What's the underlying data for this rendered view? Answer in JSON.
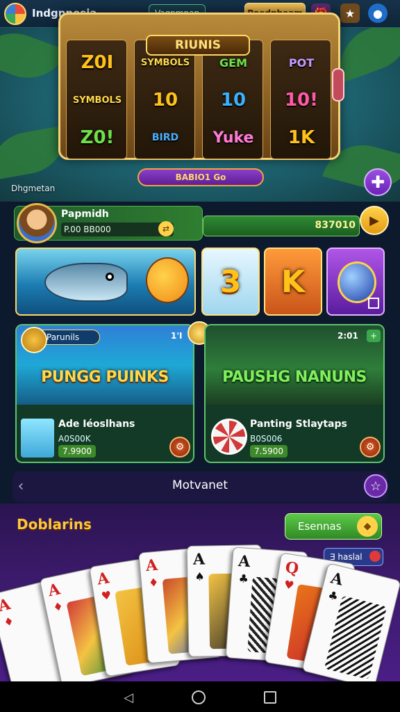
{
  "header": {
    "region": "Indgnnesia",
    "center_chip": "Vagnmpan",
    "top_button": "Poednheam"
  },
  "hero": {
    "slot_title": "RIUNIS",
    "reels": [
      [
        "Z0I",
        "SYMBOLS",
        "Z0!"
      ],
      [
        "SYMBOLS",
        "10",
        "BIRD"
      ],
      [
        "GEM",
        "10",
        "Yuke"
      ],
      [
        "POT",
        "10!",
        "1K"
      ]
    ],
    "slot_label": "BABIO1 Go",
    "caption": "Dhgmetan"
  },
  "profile": {
    "name": "Papmidh",
    "sub": "P.00 BB000",
    "balance": "837010"
  },
  "tiles": [
    {
      "label": "3"
    },
    {
      "label": "K"
    }
  ],
  "features": [
    {
      "chip": "Parunils",
      "time": "1'I",
      "title": "PUNGG PUINKS",
      "name": "Ade Iéoslhans",
      "sub": "A0S00K",
      "price": "7.9900"
    },
    {
      "time": "2:01",
      "title": "PAUSHG NANUNS",
      "name": "Panting Stlaytaps",
      "sub": "B0S006",
      "price": "7.5900"
    }
  ],
  "section_nav": {
    "title": "Motvanet"
  },
  "cards_section": {
    "heading": "Doblarins",
    "button": "Esennas",
    "chip": "∃ haslal"
  },
  "cards": [
    {
      "rank": "A",
      "suit": "♦",
      "color": "#d12020"
    },
    {
      "rank": "A",
      "suit": "♦",
      "color": "#d12020"
    },
    {
      "rank": "A",
      "suit": "♥",
      "color": "#d12020"
    },
    {
      "rank": "A",
      "suit": "♦",
      "color": "#d12020"
    },
    {
      "rank": "A",
      "suit": "♠",
      "color": "#111111"
    },
    {
      "rank": "A",
      "suit": "♣",
      "color": "#111111"
    },
    {
      "rank": "Q",
      "suit": "♥",
      "color": "#d12020"
    },
    {
      "rank": "A",
      "suit": "♣",
      "color": "#111111"
    }
  ],
  "colors": {
    "accent_gold": "#ffd24a",
    "accent_green": "#2f8a24",
    "accent_purple": "#6a2aa8"
  }
}
